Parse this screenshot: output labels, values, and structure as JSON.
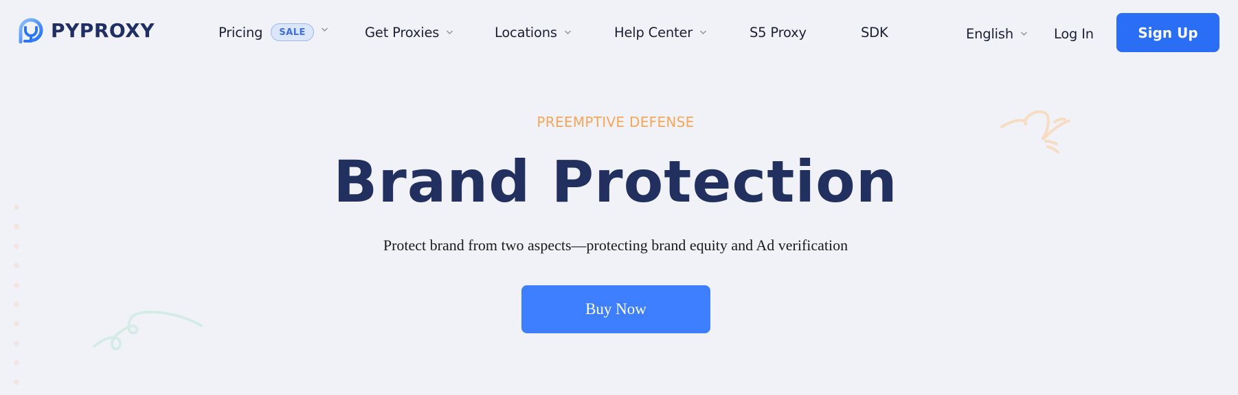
{
  "brand": {
    "name": "PYPROXY",
    "logo_icon": "pyproxy-logo-icon",
    "colors": {
      "primary": "#2b6ef6",
      "navy": "#22305f",
      "accent_orange": "#f5a65b",
      "background": "#f1f2f7"
    }
  },
  "nav": {
    "items": [
      {
        "label": "Pricing",
        "badge": "SALE",
        "has_dropdown": true
      },
      {
        "label": "Get Proxies",
        "has_dropdown": true
      },
      {
        "label": "Locations",
        "has_dropdown": true
      },
      {
        "label": "Help Center",
        "has_dropdown": true
      },
      {
        "label": "S5 Proxy",
        "has_dropdown": false
      },
      {
        "label": "SDK",
        "has_dropdown": false
      }
    ],
    "language": {
      "label": "English",
      "has_dropdown": true
    },
    "login_label": "Log In",
    "signup_label": "Sign Up"
  },
  "hero": {
    "eyebrow": "PREEMPTIVE DEFENSE",
    "title": "Brand Protection",
    "subtitle": "Protect brand from two aspects—protecting brand equity and Ad verification",
    "cta_label": "Buy Now"
  },
  "icons": {
    "dropdown": "chevron-down-icon"
  }
}
